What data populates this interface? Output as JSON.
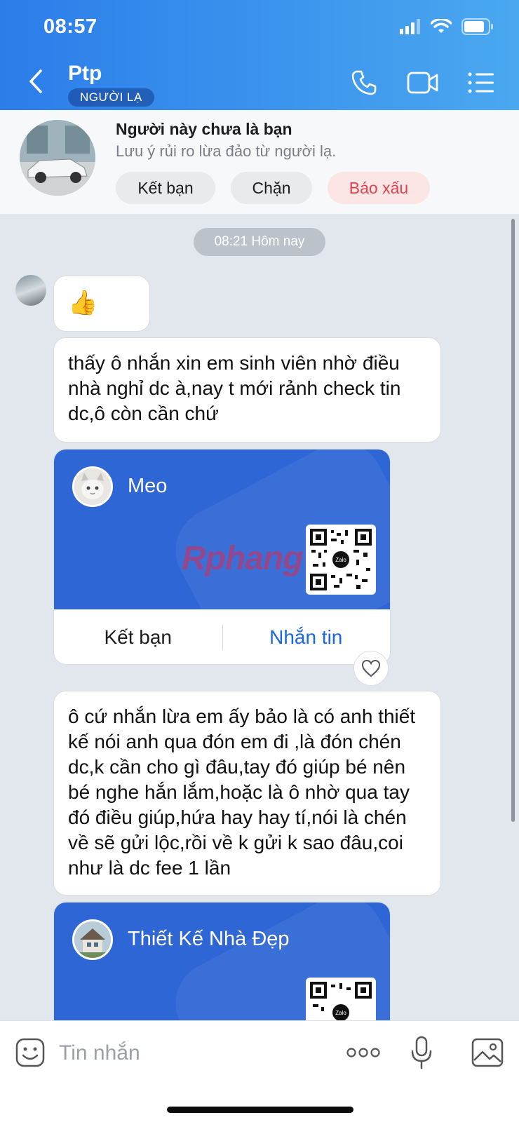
{
  "status": {
    "time": "08:57"
  },
  "header": {
    "name": "Ptp",
    "badge": "NGƯỜI LẠ"
  },
  "notice": {
    "title": "Người này chưa là bạn",
    "subtitle": "Lưu ý rủi ro lừa đảo từ người lạ.",
    "buttons": {
      "add_friend": "Kết bạn",
      "block": "Chặn",
      "report": "Báo xấu"
    }
  },
  "chat": {
    "timestamp": "08:21 Hôm nay",
    "messages": [
      {
        "text": "thấy ô nhắn xin em sinh viên nhờ điều nhà nghỉ dc à,nay t mới rảnh check tin dc,ô còn cần chứ"
      },
      {
        "text": "ô cứ nhắn lừa em ấy bảo là có anh thiết kế nói anh qua đón em đi ,là đón chén dc,k cần cho gì đâu,tay đó giúp bé nên bé nghe hắn lắm,hoặc là ô nhờ qua tay đó điều giúp,hứa hay hay tí,nói là chén về sẽ gửi lộc,rồi về k gửi k sao đâu,coi như là dc fee 1 lần"
      }
    ],
    "cards": [
      {
        "name": "Meo",
        "add_friend": "Kết bạn",
        "message": "Nhắn tin",
        "watermark": "Rphang",
        "qr_label": "Zalo"
      },
      {
        "name": "Thiết Kế Nhà Đẹp",
        "qr_label": "Zalo"
      }
    ]
  },
  "input": {
    "placeholder": "Tin nhắn"
  },
  "colors": {
    "header_start": "#2b7de9",
    "header_end": "#4aa8f0",
    "card_blue": "#2f66d6",
    "report_red": "#e0434f",
    "link_blue": "#1a67e0"
  }
}
